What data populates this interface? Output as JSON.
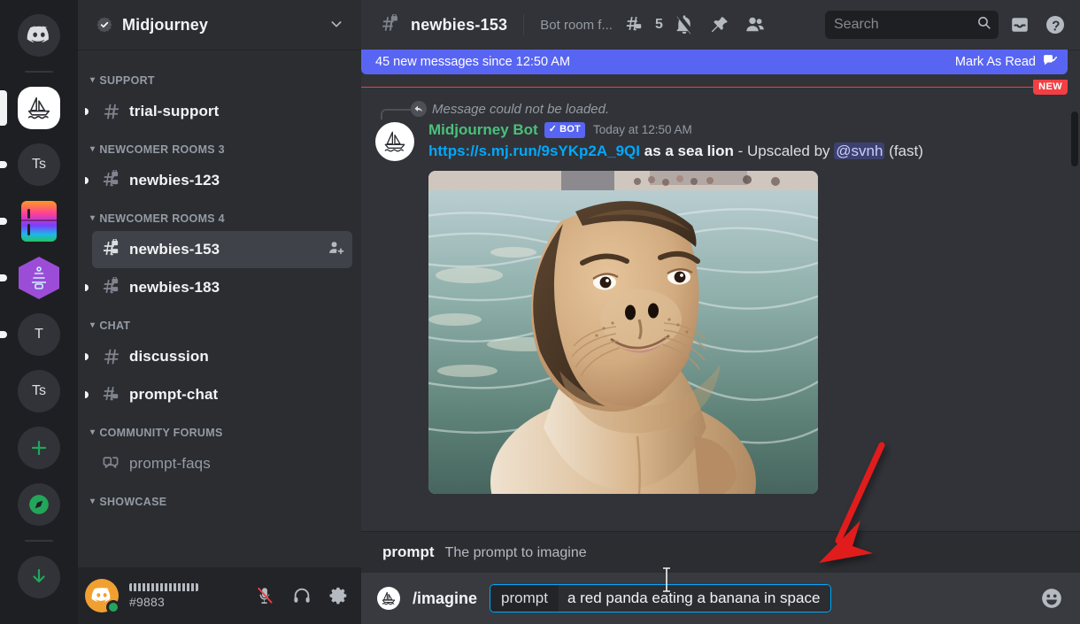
{
  "server_rail": {
    "items": [
      {
        "name": "discord-home",
        "label": "",
        "icon": "discord-logo",
        "unread": false,
        "active": false
      },
      {
        "name": "midjourney-server",
        "label": "",
        "icon": "midjourney-sail",
        "unread": false,
        "active": true
      },
      {
        "name": "server-ts-1",
        "label": "Ts",
        "icon": "text-avatar",
        "unread": true,
        "active": false
      },
      {
        "name": "server-gradient",
        "label": "",
        "icon": "gradient-fridge",
        "unread": true,
        "active": false
      },
      {
        "name": "server-hex",
        "label": "",
        "icon": "purple-hexagon",
        "unread": true,
        "active": false
      },
      {
        "name": "server-t",
        "label": "T",
        "icon": "text-avatar",
        "unread": true,
        "active": false
      },
      {
        "name": "server-ts-2",
        "label": "Ts",
        "icon": "text-avatar",
        "unread": false,
        "active": false
      }
    ],
    "add_server_label": "+",
    "explore_label": "compass",
    "download_label": "download"
  },
  "sidebar": {
    "server_name": "Midjourney",
    "verified": true,
    "categories": [
      {
        "name": "SUPPORT",
        "channels": [
          {
            "label": "trial-support",
            "icon": "hash-icon",
            "unread": true,
            "selected": false,
            "invite": false
          }
        ]
      },
      {
        "name": "NEWCOMER ROOMS 3",
        "channels": [
          {
            "label": "newbies-123",
            "icon": "hash-lock-icon",
            "unread": true,
            "selected": false,
            "invite": false
          }
        ]
      },
      {
        "name": "NEWCOMER ROOMS 4",
        "channels": [
          {
            "label": "newbies-153",
            "icon": "hash-lock-icon",
            "unread": false,
            "selected": true,
            "invite": true
          },
          {
            "label": "newbies-183",
            "icon": "hash-lock-icon",
            "unread": true,
            "selected": false,
            "invite": false
          }
        ]
      },
      {
        "name": "CHAT",
        "channels": [
          {
            "label": "discussion",
            "icon": "hash-icon",
            "unread": true,
            "selected": false,
            "invite": false
          },
          {
            "label": "prompt-chat",
            "icon": "hash-thread-icon",
            "unread": true,
            "selected": false,
            "invite": false
          }
        ]
      },
      {
        "name": "COMMUNITY FORUMS",
        "channels": [
          {
            "label": "prompt-faqs",
            "icon": "forum-icon",
            "unread": false,
            "selected": false,
            "invite": false
          }
        ]
      },
      {
        "name": "SHOWCASE",
        "channels": []
      }
    ]
  },
  "user_panel": {
    "username_redacted": true,
    "tag": "#9883",
    "status": "online",
    "mic_muted": true,
    "mic_label": "Mute",
    "headset_label": "Deafen",
    "settings_label": "User Settings"
  },
  "topbar": {
    "channel_name": "newbies-153",
    "channel_icon": "hash-lock-icon",
    "topic": "Bot room f...",
    "thread_count": "5",
    "notifications_muted": true,
    "pins_label": "Pinned Messages",
    "members_label": "Member List",
    "inbox_label": "Inbox",
    "help_label": "Help"
  },
  "search": {
    "placeholder": "Search",
    "value": ""
  },
  "new_messages_banner": {
    "text": "45 new messages since 12:50 AM",
    "mark_as_read": "Mark As Read",
    "new_pill": "NEW",
    "color": "#5865f2",
    "divider_color": "#f23f43"
  },
  "message": {
    "reply_context": "Message could not be loaded.",
    "author": "Midjourney Bot",
    "author_color": "#4ac07a",
    "bot_badge": "BOT",
    "timestamp": "Today at 12:50 AM",
    "link": "https://s.mj.run/9sYKp2A_9QI",
    "prompt_text": "as a sea lion",
    "upscaled_by": "- Upscaled by",
    "mention": "@svnh",
    "speed": "(fast)",
    "attachment_alt": "AI generated sea lion with human-like face in water"
  },
  "command_hint": {
    "key": "prompt",
    "description": "The prompt to imagine"
  },
  "input": {
    "command": "/imagine",
    "chip_key": "prompt",
    "chip_value": "a red panda eating a banana in space",
    "emoji_label": "emoji-picker",
    "border_color": "#00a8fc"
  }
}
